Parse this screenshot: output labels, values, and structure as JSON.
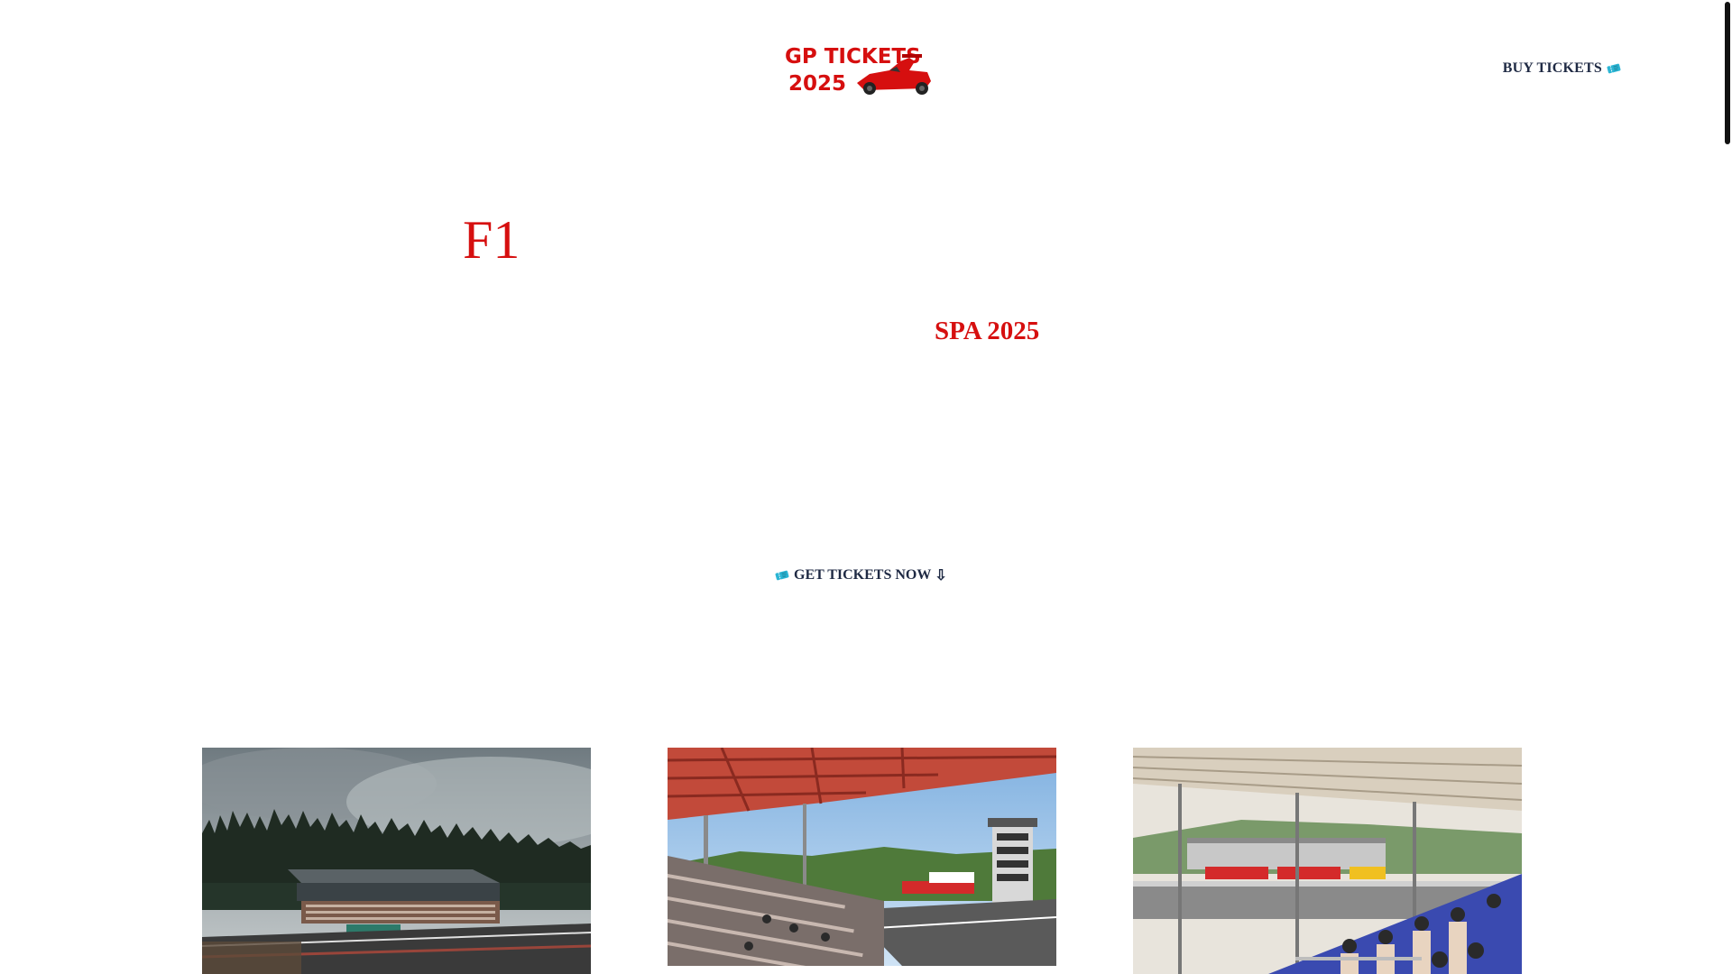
{
  "header": {
    "logo_line1": "GP TICKETS",
    "logo_line2": "2025",
    "buy_tickets_label": "BUY TICKETS",
    "ticket_icon": "ticket-icon"
  },
  "hero": {
    "title_part1": "F1",
    "title_part2": "SPA 2025",
    "cta_label": "GET TICKETS NOW",
    "cta_arrow": "⇩"
  },
  "gallery": {
    "images": [
      {
        "name": "forest-grandstand-photo"
      },
      {
        "name": "covered-grandstand-photo"
      },
      {
        "name": "spectator-stand-photo"
      }
    ]
  },
  "colors": {
    "accent_red": "#d60f0f",
    "nav_text": "#1f2a44",
    "ticket_icon": "#2bb5d4"
  }
}
